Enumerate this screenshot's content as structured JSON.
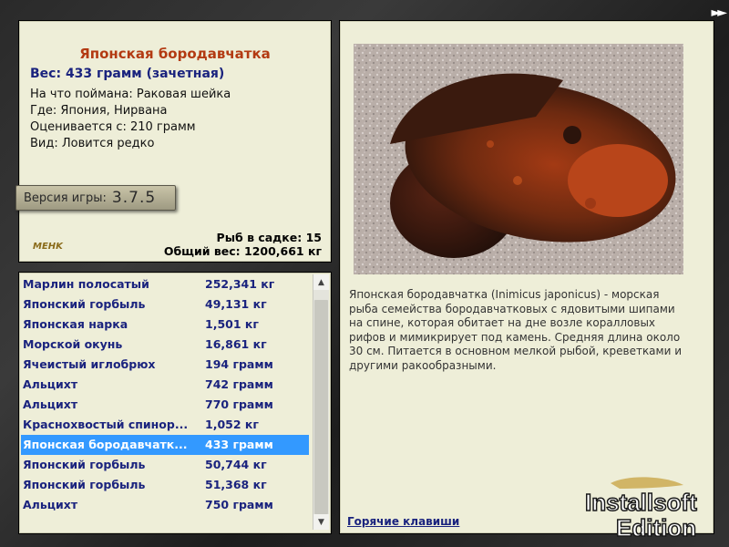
{
  "fish": {
    "title": "Японская бородавчатка",
    "weight": "Вес: 433 грамм (зачетная)",
    "caught_with": "На что поймана: Раковая шейка",
    "location": "Где: Япония, Нирвана",
    "valued_from": "Оценивается с: 210 грамм",
    "kind": "Вид: Ловится редко"
  },
  "version": {
    "label": "Версия игры:",
    "number": "3.7.5"
  },
  "small_logo": "MEHK",
  "stats": {
    "fish_in_cage": "Рыб в садке: 15",
    "total_weight": "Общий вес: 1200,661 кг"
  },
  "list": [
    {
      "name": "Марлин полосатый",
      "weight": "252,341 кг"
    },
    {
      "name": "Японский горбыль",
      "weight": "49,131 кг"
    },
    {
      "name": "Японская нарка",
      "weight": "1,501 кг"
    },
    {
      "name": "Морской окунь",
      "weight": "16,861 кг"
    },
    {
      "name": "Ячеистый иглобрюх",
      "weight": "194 грамм"
    },
    {
      "name": "Альцихт",
      "weight": "742 грамм"
    },
    {
      "name": "Альцихт",
      "weight": "770 грамм"
    },
    {
      "name": "Краснохвостый спинор...",
      "weight": "1,052 кг"
    },
    {
      "name": "Японская бородавчатк...",
      "weight": "433 грамм"
    },
    {
      "name": "Японский горбыль",
      "weight": "50,744 кг"
    },
    {
      "name": "Японский горбыль",
      "weight": "51,368 кг"
    },
    {
      "name": "Альцихт",
      "weight": "750 грамм"
    }
  ],
  "selected_index": 8,
  "description": "Японская бородавчатка (Inimicus japonicus) - морская рыба семейства бородавчатковых с ядовитыми шипами на спине, которая обитает на дне возле коралловых рифов и мимикрирует под камень. Средняя длина  около 30 см. Питается в основном мелкой рыбой, креветками и другими ракообразными.",
  "hotkeys": "Горячие клавиши",
  "nav_arrow": "►►",
  "watermark": {
    "line1": "Installsoft",
    "line2": "Edition"
  },
  "icons": {
    "scroll_up": "triangle-up",
    "scroll_down": "triangle-down",
    "next": "double-arrow-right"
  }
}
